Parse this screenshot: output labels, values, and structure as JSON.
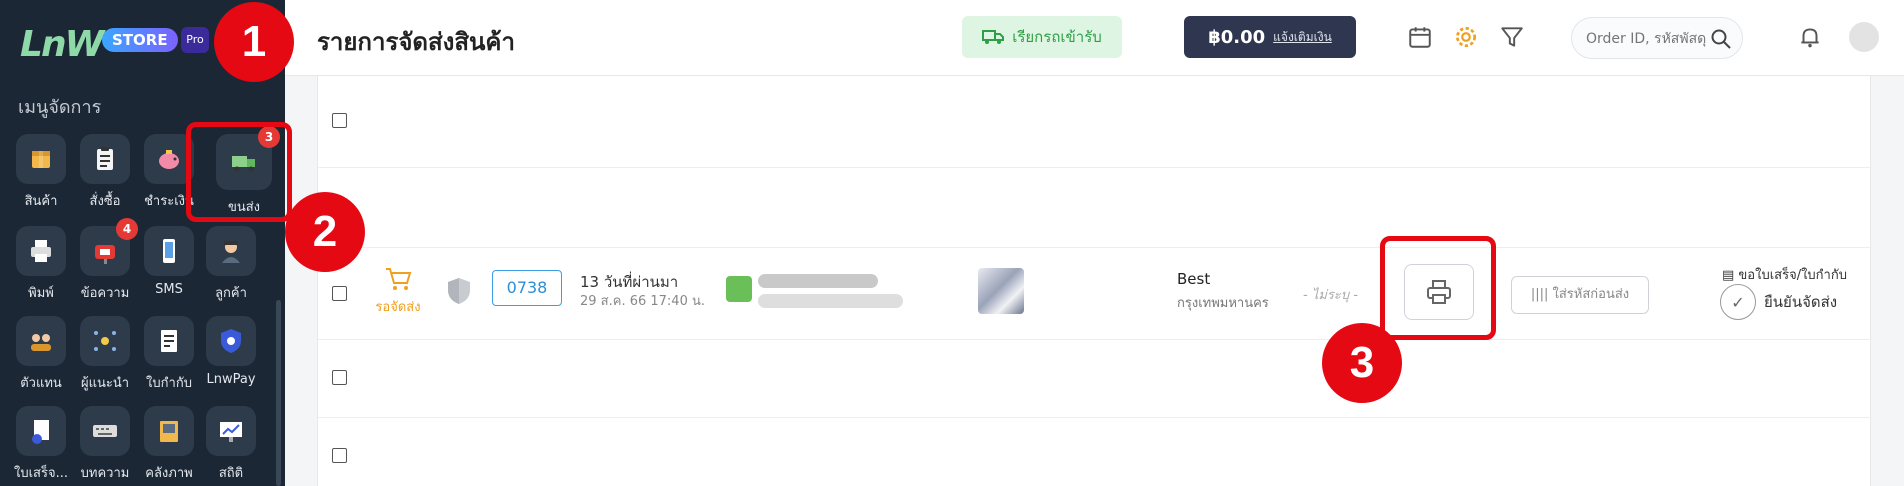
{
  "sidebar": {
    "brand_logo": "LnW",
    "brand_store": "STORE",
    "brand_pro": "Pro",
    "menu_title": "เมนูจัดการ",
    "items": [
      {
        "label": "สินค้า",
        "icon": "box-icon"
      },
      {
        "label": "สั่งซื้อ",
        "icon": "clipboard-icon"
      },
      {
        "label": "ชำระเงิน",
        "icon": "piggy-bank-icon"
      },
      {
        "label": "ขนส่ง",
        "icon": "truck-icon",
        "badge": "3"
      },
      {
        "label": "พิมพ์",
        "icon": "printer-icon"
      },
      {
        "label": "ข้อความ",
        "icon": "mailbox-icon",
        "badge": "4"
      },
      {
        "label": "SMS",
        "icon": "phone-icon"
      },
      {
        "label": "ลูกค้า",
        "icon": "customer-icon"
      },
      {
        "label": "ตัวแทน",
        "icon": "agents-icon"
      },
      {
        "label": "ผู้แนะนำ",
        "icon": "referrer-icon"
      },
      {
        "label": "ใบกำกับ",
        "icon": "invoice-icon"
      },
      {
        "label": "LnwPay",
        "icon": "shield-pay-icon"
      },
      {
        "label": "ใบเสร็จ...",
        "icon": "receipt-icon"
      },
      {
        "label": "บทความ",
        "icon": "keyboard-icon"
      },
      {
        "label": "คลังภาพ",
        "icon": "gallery-icon"
      },
      {
        "label": "สถิติ",
        "icon": "stats-icon"
      }
    ]
  },
  "header": {
    "title": "รายการจัดส่งสินค้า",
    "call_truck_label": "เรียกรถเข้ารับ",
    "wallet_amount": "฿0.00",
    "wallet_topup": "แจ้งเติมเงิน",
    "search_placeholder": "Order ID, รหัสพัสดุ"
  },
  "callouts": {
    "one": "1",
    "two": "2",
    "three": "3"
  },
  "order": {
    "status": "รอจัดส่ง",
    "id": "0738",
    "time_ago": "13 วันที่ผ่านมา",
    "date": "29 ส.ค. 66 17:40 น.",
    "shipping_name": "Best",
    "shipping_area": "กรุงเทพมหานคร",
    "tracking": "- ไม่ระบุ -",
    "code_button": "ใส่รหัสก่อนส่ง",
    "invoice_label": "ขอใบเสร็จ/ใบกำกับ",
    "confirm_label": "ยืนยันจัดส่ง"
  },
  "colors": {
    "sidebar_bg": "#1b2734",
    "accent_red": "#e50914",
    "status_orange": "#f0a020",
    "order_blue": "#2a8fd6",
    "call_green": "#2e9f46"
  }
}
